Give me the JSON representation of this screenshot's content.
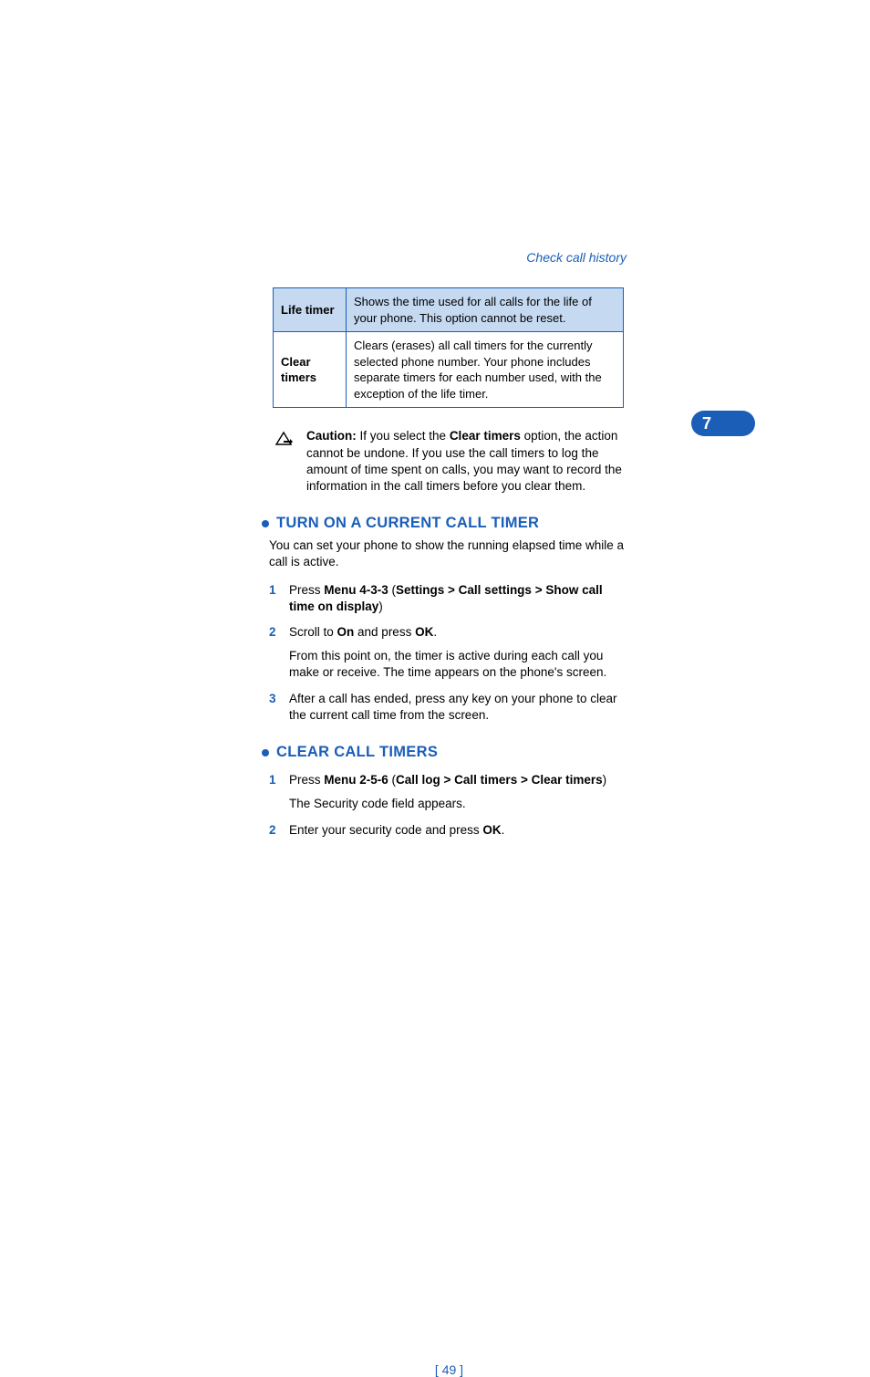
{
  "running_header": "Check call history",
  "chapter_number": "7",
  "table": {
    "rows": [
      {
        "label": "Life timer",
        "desc": "Shows the time used for all calls for the life of your phone. This option cannot be reset."
      },
      {
        "label": "Clear timers",
        "desc": "Clears (erases) all call timers for the currently selected phone number. Your phone includes separate timers for each number used, with the exception of the life timer."
      }
    ]
  },
  "caution": {
    "label": "Caution:",
    "text_before_bold": " If you select the ",
    "bold": "Clear timers",
    "text_after": " option, the action cannot be undone. If you use the call timers to log the amount of time spent on calls, you may want to record the information in the call timers before you clear them."
  },
  "sections": [
    {
      "heading": "TURN ON A CURRENT CALL TIMER",
      "intro": "You can set your phone to show the running elapsed time while a call is active.",
      "steps": [
        {
          "pre": "Press ",
          "bold1": "Menu 4-3-3",
          "mid1": " (",
          "bold2": "Settings > Call settings > Show call time on display",
          "post": ")"
        },
        {
          "pre": "Scroll to ",
          "bold1": "On",
          "mid1": " and press ",
          "bold2": "OK",
          "post": ".",
          "sub": "From this point on, the timer is active during each call you make or receive. The time appears on the phone's screen."
        },
        {
          "pre": "After a call has ended, press any key on your phone to clear the current call time from the screen."
        }
      ]
    },
    {
      "heading": "CLEAR CALL TIMERS",
      "steps": [
        {
          "pre": "Press ",
          "bold1": "Menu 2-5-6",
          "mid1": " (",
          "bold2": "Call log > Call timers > Clear timers",
          "post": ")",
          "sub": "The Security code field appears."
        },
        {
          "pre": "Enter your security code and press ",
          "bold1": "OK",
          "post": "."
        }
      ]
    }
  ],
  "page_number": "[ 49 ]"
}
